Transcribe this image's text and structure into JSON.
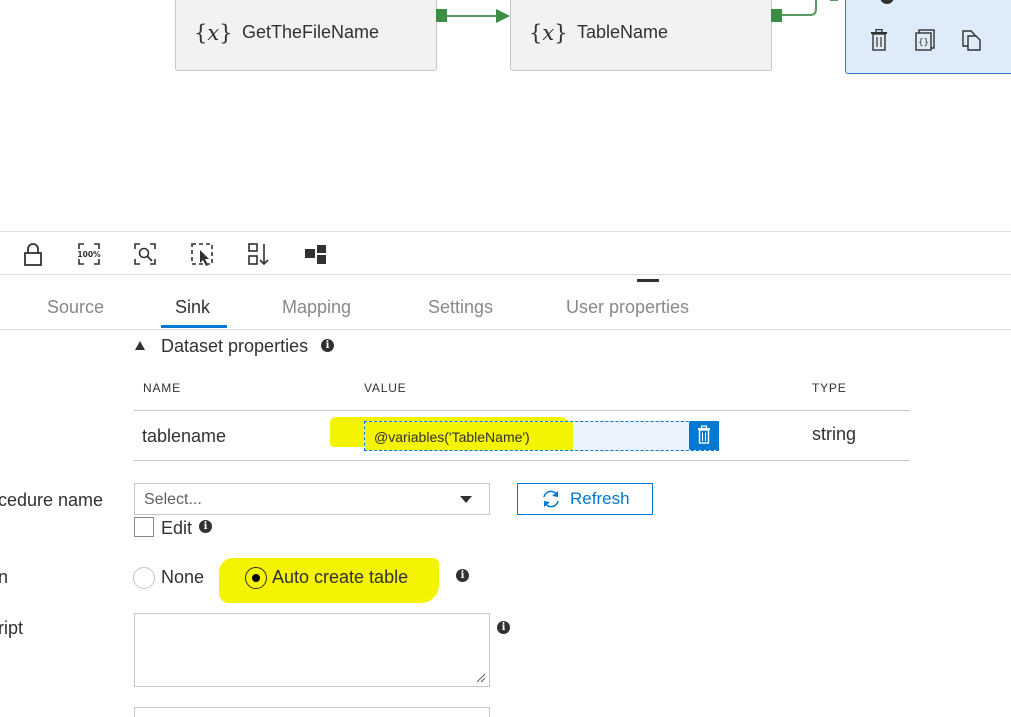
{
  "pipeline": {
    "activities": [
      {
        "name": "GetTheFileName",
        "icon": "variable-icon"
      },
      {
        "name": "TableName",
        "icon": "variable-icon"
      }
    ],
    "copy_activity": {
      "icons": [
        "delete-icon",
        "code-icon",
        "clone-icon"
      ]
    }
  },
  "toolbar": {
    "icons": [
      "lock-icon",
      "zoom-100-icon",
      "zoom-to-fit-icon",
      "select-icon",
      "auto-align-icon",
      "layout-icon"
    ]
  },
  "tabs": [
    "Source",
    "Sink",
    "Mapping",
    "Settings",
    "User properties"
  ],
  "active_tab": "Sink",
  "dataset_properties": {
    "title": "Dataset properties",
    "columns": {
      "name": "NAME",
      "value": "VALUE",
      "type": "TYPE"
    },
    "rows": [
      {
        "name": "tablename",
        "value": "@variables('TableName')",
        "type": "string"
      }
    ]
  },
  "stored_procedure": {
    "label": "cedure name",
    "placeholder": "Select...",
    "refresh_label": "Refresh",
    "edit_label": "Edit"
  },
  "table_option": {
    "label": "n",
    "options": [
      "None",
      "Auto create table"
    ],
    "selected": "Auto create table"
  },
  "pre_copy_script": {
    "label": "ript"
  },
  "colors": {
    "accent": "#0078d4",
    "highlight": "#f4f400",
    "connector": "#3a8d45"
  }
}
